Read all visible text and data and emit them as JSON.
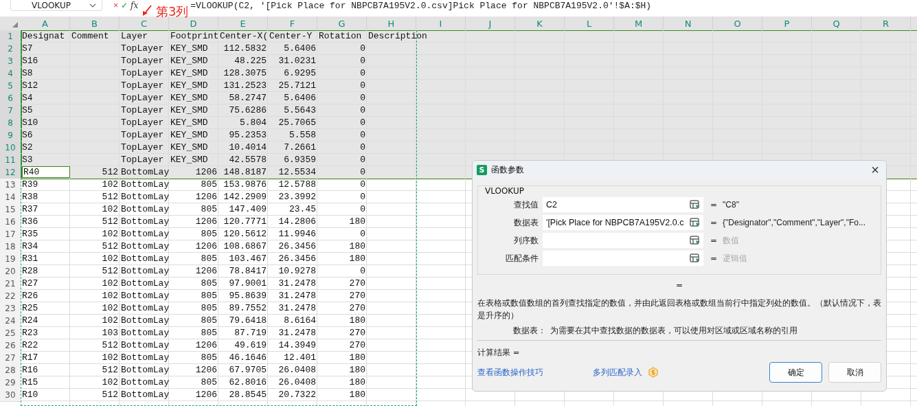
{
  "name_box": {
    "value": "VLOOKUP"
  },
  "formula_bar": {
    "cancel": "×",
    "confirm": "✓",
    "fx": "fx",
    "formula": "=VLOOKUP(C2, '[Pick Place for NBPCB7A195V2.0.csv]Pick Place for NBPCB7A195V2.0'!$A:$H)"
  },
  "annotation": {
    "label": "第3列"
  },
  "columns": [
    "A",
    "B",
    "C",
    "D",
    "E",
    "F",
    "G",
    "H",
    "I",
    "J",
    "K",
    "L",
    "M",
    "N",
    "O",
    "P",
    "Q",
    "R"
  ],
  "rows": [
    {
      "number": "1",
      "selected": true,
      "active": false,
      "cells": {
        "A": "Designat",
        "B": "Comment",
        "C": "Layer",
        "D": "Footprint",
        "E": "Center-X(",
        "F": "Center-Y",
        "G": "Rotation",
        "H": "Description"
      }
    },
    {
      "number": "2",
      "selected": true,
      "active": false,
      "cells": {
        "A": "S7",
        "C": "TopLayer",
        "D": "KEY_SMD",
        "E": "112.5832",
        "F": "5.6406",
        "G": "0"
      }
    },
    {
      "number": "3",
      "selected": true,
      "active": false,
      "cells": {
        "A": "S16",
        "C": "TopLayer",
        "D": "KEY_SMD",
        "E": "48.225",
        "F": "31.0231",
        "G": "0"
      }
    },
    {
      "number": "4",
      "selected": true,
      "active": false,
      "cells": {
        "A": "S8",
        "C": "TopLayer",
        "D": "KEY_SMD",
        "E": "128.3075",
        "F": "6.9295",
        "G": "0"
      }
    },
    {
      "number": "5",
      "selected": true,
      "active": false,
      "cells": {
        "A": "S12",
        "C": "TopLayer",
        "D": "KEY_SMD",
        "E": "131.2523",
        "F": "25.7121",
        "G": "0"
      }
    },
    {
      "number": "6",
      "selected": true,
      "active": false,
      "cells": {
        "A": "S4",
        "C": "TopLayer",
        "D": "KEY_SMD",
        "E": "58.2747",
        "F": "5.6406",
        "G": "0"
      }
    },
    {
      "number": "7",
      "selected": true,
      "active": false,
      "cells": {
        "A": "S5",
        "C": "TopLayer",
        "D": "KEY_SMD",
        "E": "75.6286",
        "F": "5.5643",
        "G": "0"
      }
    },
    {
      "number": "8",
      "selected": true,
      "active": false,
      "cells": {
        "A": "S10",
        "C": "TopLayer",
        "D": "KEY_SMD",
        "E": "5.804",
        "F": "25.7065",
        "G": "0"
      }
    },
    {
      "number": "9",
      "selected": true,
      "active": false,
      "cells": {
        "A": "S6",
        "C": "TopLayer",
        "D": "KEY_SMD",
        "E": "95.2353",
        "F": "5.558",
        "G": "0"
      }
    },
    {
      "number": "10",
      "selected": true,
      "active": false,
      "cells": {
        "A": "S2",
        "C": "TopLayer",
        "D": "KEY_SMD",
        "E": "10.4014",
        "F": "7.2661",
        "G": "0"
      }
    },
    {
      "number": "11",
      "selected": true,
      "active": false,
      "cells": {
        "A": "S3",
        "C": "TopLayer",
        "D": "KEY_SMD",
        "E": "42.5578",
        "F": "6.9359",
        "G": "0"
      }
    },
    {
      "number": "12",
      "selected": true,
      "active": true,
      "cells": {
        "A": "R40",
        "B": "512",
        "C": "BottomLay",
        "D": "1206",
        "E": "148.8187",
        "F": "12.5534",
        "G": "0"
      }
    },
    {
      "number": "13",
      "selected": false,
      "active": false,
      "cells": {
        "A": "R39",
        "B": "102",
        "C": "BottomLay",
        "D": "805",
        "E": "153.9876",
        "F": "12.5788",
        "G": "0"
      }
    },
    {
      "number": "14",
      "selected": false,
      "active": false,
      "cells": {
        "A": "R38",
        "B": "512",
        "C": "BottomLay",
        "D": "1206",
        "E": "142.2909",
        "F": "23.3992",
        "G": "0"
      }
    },
    {
      "number": "15",
      "selected": false,
      "active": false,
      "cells": {
        "A": "R37",
        "B": "102",
        "C": "BottomLay",
        "D": "805",
        "E": "147.409",
        "F": "23.45",
        "G": "0"
      }
    },
    {
      "number": "16",
      "selected": false,
      "active": false,
      "cells": {
        "A": "R36",
        "B": "512",
        "C": "BottomLay",
        "D": "1206",
        "E": "120.7771",
        "F": "14.2806",
        "G": "180"
      }
    },
    {
      "number": "17",
      "selected": false,
      "active": false,
      "cells": {
        "A": "R35",
        "B": "102",
        "C": "BottomLay",
        "D": "805",
        "E": "120.5612",
        "F": "11.9946",
        "G": "0"
      }
    },
    {
      "number": "18",
      "selected": false,
      "active": false,
      "cells": {
        "A": "R34",
        "B": "512",
        "C": "BottomLay",
        "D": "1206",
        "E": "108.6867",
        "F": "26.3456",
        "G": "180"
      }
    },
    {
      "number": "19",
      "selected": false,
      "active": false,
      "cells": {
        "A": "R31",
        "B": "102",
        "C": "BottomLay",
        "D": "805",
        "E": "103.467",
        "F": "26.3456",
        "G": "180"
      }
    },
    {
      "number": "20",
      "selected": false,
      "active": false,
      "cells": {
        "A": "R28",
        "B": "512",
        "C": "BottomLay",
        "D": "1206",
        "E": "78.8417",
        "F": "10.9278",
        "G": "0"
      }
    },
    {
      "number": "21",
      "selected": false,
      "active": false,
      "cells": {
        "A": "R27",
        "B": "102",
        "C": "BottomLay",
        "D": "805",
        "E": "97.9001",
        "F": "31.2478",
        "G": "270"
      }
    },
    {
      "number": "22",
      "selected": false,
      "active": false,
      "cells": {
        "A": "R26",
        "B": "102",
        "C": "BottomLay",
        "D": "805",
        "E": "95.8639",
        "F": "31.2478",
        "G": "270"
      }
    },
    {
      "number": "23",
      "selected": false,
      "active": false,
      "cells": {
        "A": "R25",
        "B": "102",
        "C": "BottomLay",
        "D": "805",
        "E": "89.7552",
        "F": "31.2478",
        "G": "270"
      }
    },
    {
      "number": "24",
      "selected": false,
      "active": false,
      "cells": {
        "A": "R24",
        "B": "102",
        "C": "BottomLay",
        "D": "805",
        "E": "79.6418",
        "F": "8.6164",
        "G": "180"
      }
    },
    {
      "number": "25",
      "selected": false,
      "active": false,
      "cells": {
        "A": "R23",
        "B": "103",
        "C": "BottomLay",
        "D": "805",
        "E": "87.719",
        "F": "31.2478",
        "G": "270"
      }
    },
    {
      "number": "26",
      "selected": false,
      "active": false,
      "cells": {
        "A": "R22",
        "B": "512",
        "C": "BottomLay",
        "D": "1206",
        "E": "49.619",
        "F": "14.3949",
        "G": "270"
      }
    },
    {
      "number": "27",
      "selected": false,
      "active": false,
      "cells": {
        "A": "R17",
        "B": "102",
        "C": "BottomLay",
        "D": "805",
        "E": "46.1646",
        "F": "12.401",
        "G": "180"
      }
    },
    {
      "number": "28",
      "selected": false,
      "active": false,
      "cells": {
        "A": "R16",
        "B": "512",
        "C": "BottomLay",
        "D": "1206",
        "E": "67.9705",
        "F": "26.0408",
        "G": "180"
      }
    },
    {
      "number": "29",
      "selected": false,
      "active": false,
      "cells": {
        "A": "R15",
        "B": "102",
        "C": "BottomLay",
        "D": "805",
        "E": "62.8016",
        "F": "26.0408",
        "G": "180"
      }
    },
    {
      "number": "30",
      "selected": false,
      "active": false,
      "cells": {
        "A": "R10",
        "B": "512",
        "C": "BottomLay",
        "D": "1206",
        "E": "28.8545",
        "F": "20.7322",
        "G": "180"
      }
    }
  ],
  "dialog": {
    "app_icon": "S",
    "title": "函数参数",
    "close": "×",
    "function_name": "VLOOKUP",
    "arguments": [
      {
        "label": "查找值",
        "value": "C2",
        "equals": "=",
        "result": "\"C8\"",
        "result_muted": false
      },
      {
        "label": "数据表",
        "value": "'[Pick Place for NBPCB7A195V2.0.c",
        "equals": "=",
        "result": "{\"Designator\",\"Comment\",\"Layer\",\"Fo...",
        "result_muted": false
      },
      {
        "label": "列序数",
        "equals": "=",
        "result": "数值",
        "result_muted": true
      },
      {
        "label": "匹配条件",
        "equals": "=",
        "result": "逻辑值",
        "result_muted": true
      }
    ],
    "formula_result": "=",
    "description": "在表格或数值数组的首列查找指定的数值，并由此返回表格或数组当前行中指定列处的数值。（默认情况下，表是升序的）",
    "argument_help": {
      "name": "数据表：",
      "text": "为需要在其中查找数据的数据表，可以使用对区域或区域名称的引用"
    },
    "result_label": "计算结果 =",
    "links": [
      "查看函数操作技巧",
      "多列匹配录入"
    ],
    "buttons": [
      {
        "label": "确定",
        "default": true
      },
      {
        "label": "取消",
        "default": false
      }
    ]
  }
}
